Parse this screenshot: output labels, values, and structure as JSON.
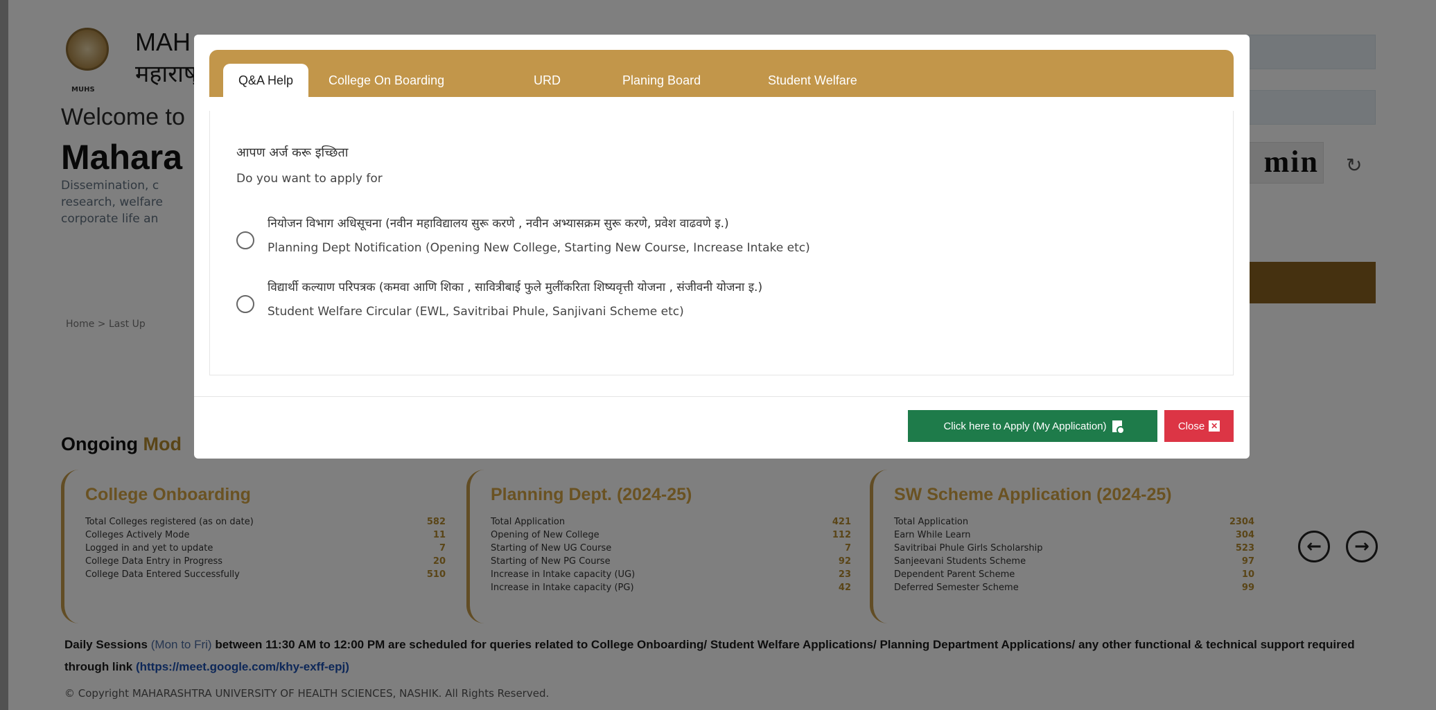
{
  "background": {
    "logo_caption": "MUHS",
    "uni_name_en": "MAH",
    "uni_name_mr": "महाराष्",
    "welcome": "Welcome to",
    "portal_title": "Mahara",
    "portal_desc": "Dissemination, c research, welfare corporate life an",
    "captcha_text": "min",
    "breadcrumb": "Home > Last Up",
    "ongoing_title_1": "Ongoing",
    "ongoing_title_2": "Mod",
    "cards": [
      {
        "title": "College Onboarding",
        "rows": [
          {
            "label": "Total Colleges registered (as on date)",
            "value": "582"
          },
          {
            "label": "Colleges Actively Mode",
            "value": "11"
          },
          {
            "label": "Logged in and yet to update",
            "value": "7"
          },
          {
            "label": "College Data Entry in Progress",
            "value": "20"
          },
          {
            "label": "College Data Entered Successfully",
            "value": "510"
          }
        ]
      },
      {
        "title": "Planning Dept. (2024-25)",
        "rows": [
          {
            "label": "Total Application",
            "value": "421"
          },
          {
            "label": "Opening of New College",
            "value": "112"
          },
          {
            "label": "Starting of New UG Course",
            "value": "7"
          },
          {
            "label": "Starting of New PG Course",
            "value": "92"
          },
          {
            "label": "Increase in Intake capacity (UG)",
            "value": "23"
          },
          {
            "label": "Increase in Intake capacity (PG)",
            "value": "42"
          }
        ]
      },
      {
        "title": "SW Scheme Application (2024-25)",
        "rows": [
          {
            "label": "Total Application",
            "value": "2304"
          },
          {
            "label": "Earn While Learn",
            "value": "304"
          },
          {
            "label": "Savitribai Phule Girls Scholarship",
            "value": "523"
          },
          {
            "label": "Sanjeevani Students Scheme",
            "value": "97"
          },
          {
            "label": "Dependent Parent Scheme",
            "value": "10"
          },
          {
            "label": "Deferred Semester Scheme",
            "value": "99"
          }
        ]
      }
    ],
    "sessions_bold_1": "Daily Sessions",
    "sessions_muted": "(Mon to Fri)",
    "sessions_bold_2": "between 11:30 AM to 12:00 PM are scheduled for queries related to College Onboarding/ Student Welfare Applications/ Planning Department Applications/ any other functional & technical support required through link",
    "sessions_link": "(https://meet.google.com/khy-exff-epj)",
    "copyright": "© Copyright MAHARASHTRA UNIVERSITY OF HEALTH SCIENCES, NASHIK. All Rights Reserved."
  },
  "modal": {
    "tabs": [
      {
        "label": "Q&A Help",
        "active": true
      },
      {
        "label": "College On Boarding",
        "active": false
      },
      {
        "label": "URD",
        "active": false
      },
      {
        "label": "Planing Board",
        "active": false
      },
      {
        "label": "Student Welfare",
        "active": false
      }
    ],
    "question_mr": "आपण अर्ज करू इच्छिता",
    "question_en": "Do you want to apply for",
    "options": [
      {
        "label_mr": "नियोजन विभाग अधिसूचना (नवीन महाविद्यालय सुरू करणे , नवीन अभ्यासक्रम सुरू करणे, प्रवेश वाढवणे इ.)",
        "label_en": "Planning Dept Notification (Opening New College, Starting New Course, Increase Intake etc)"
      },
      {
        "label_mr": "विद्यार्थी कल्याण परिपत्रक (कमवा आणि शिका , सावित्रीबाई फुले मुलींकरिता शिष्यवृत्ती योजना , संजीवनी योजना इ.)",
        "label_en": "Student Welfare Circular (EWL, Savitribai Phule, Sanjivani Scheme etc)"
      }
    ],
    "apply_button": "Click here to Apply (My Application)",
    "close_button": "Close"
  },
  "colors": {
    "tab_bar": "#c2964a",
    "apply_green": "#1e7b4a",
    "close_red": "#dc3545",
    "card_title_gold": "#d4a545"
  }
}
